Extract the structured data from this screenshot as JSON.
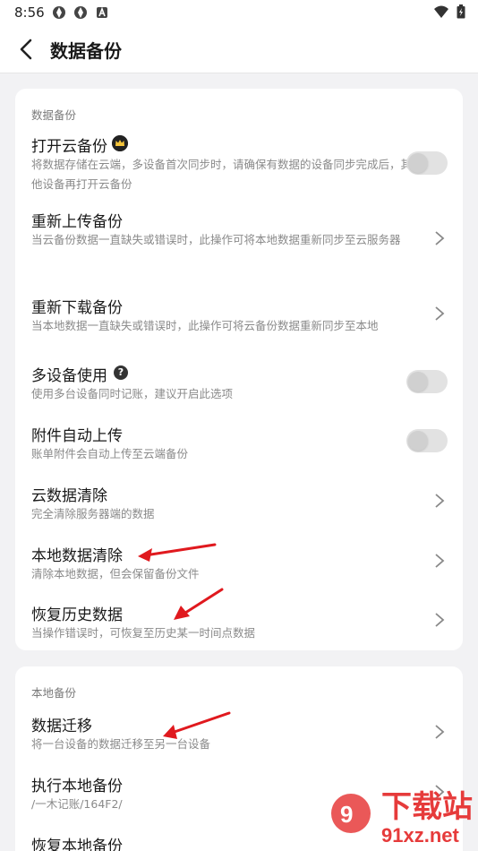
{
  "status_bar": {
    "time": "8:56"
  },
  "header": {
    "title": "数据备份"
  },
  "sections": [
    {
      "label": "数据备份",
      "rows": [
        {
          "title": "打开云备份",
          "desc": "将数据存储在云端，多设备首次同步时，请确保有数据的设备同步完成后，其他设备再打开云备份",
          "control": "toggle",
          "checked": false,
          "badge": "crown-icon"
        },
        {
          "title": "重新上传备份",
          "desc": "当云备份数据一直缺失或错误时，此操作可将本地数据重新同步至云服务器",
          "control": "chevron"
        },
        {
          "title": "重新下载备份",
          "desc": "当本地数据一直缺失或错误时，此操作可将云备份数据重新同步至本地",
          "control": "chevron"
        },
        {
          "title": "多设备使用",
          "desc": "使用多台设备同时记账，建议开启此选项",
          "control": "toggle",
          "checked": false,
          "badge": "help-icon"
        },
        {
          "title": "附件自动上传",
          "desc": "账单附件会自动上传至云端备份",
          "control": "toggle",
          "checked": false
        },
        {
          "title": "云数据清除",
          "desc": "完全清除服务器端的数据",
          "control": "chevron"
        },
        {
          "title": "本地数据清除",
          "desc": "清除本地数据，但会保留备份文件",
          "control": "chevron"
        },
        {
          "title": "恢复历史数据",
          "desc": "当操作错误时，可恢复至历史某一时间点数据",
          "control": "chevron"
        }
      ]
    },
    {
      "label": "本地备份",
      "rows": [
        {
          "title": "数据迁移",
          "desc": "将一台设备的数据迁移至另一台设备",
          "control": "chevron"
        },
        {
          "title": "执行本地备份",
          "desc": "/一木记账/164F2/",
          "control": "chevron"
        },
        {
          "title": "恢复本地备份",
          "desc": "",
          "control": "chevron"
        }
      ]
    }
  ],
  "watermark": {
    "text": "下载站",
    "url": "91xz.net"
  },
  "colors": {
    "annotation_arrow": "#e0191e",
    "toggle_off": "#e2e2e2",
    "background": "#f2f2f4"
  }
}
